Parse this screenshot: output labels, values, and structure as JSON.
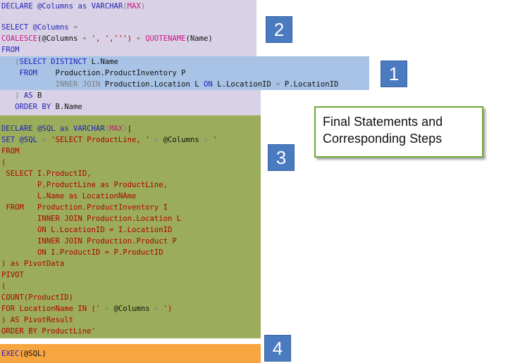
{
  "callout": {
    "line1": "Final Statements and",
    "line2": "Corresponding Steps"
  },
  "badges": [
    "2",
    "1",
    "3",
    "4"
  ],
  "colors": {
    "step2_bg": "#d9d2e6",
    "step1_bg": "#a8c3e6",
    "step3_bg": "#9bad5b",
    "step4_bg": "#f7a541",
    "badge_bg": "#4a7ac0",
    "callout_border": "#6aaa3a"
  },
  "step2": {
    "declare": [
      "DECLARE @Columns ",
      "as ",
      "VARCHAR",
      "(",
      "MAX",
      ")"
    ],
    "select": [
      "SELECT @Columns ",
      "="
    ],
    "coalesce": [
      "COALESCE",
      "(@Columns ",
      "+ ",
      "', ','",
      "'') ",
      "+ ",
      "QUOTENAME",
      "(Name)"
    ],
    "from": "FROM",
    "as_b": [
      "   ) ",
      "AS ",
      "B"
    ],
    "order": [
      "   ",
      "ORDER BY ",
      "B.Name"
    ]
  },
  "step1": {
    "line1": [
      "   (",
      "SELECT DISTINCT ",
      "L.Name"
    ],
    "line2": [
      "    ",
      "FROM    ",
      "Production.ProductInventory P"
    ],
    "line3": [
      "            ",
      "INNER JOIN ",
      "Production.Location L ",
      "ON ",
      "L.LocationID ",
      "= ",
      "P.LocationID"
    ]
  },
  "step3": {
    "lines": [
      "DECLARE @SQL as VARCHAR(MAX)",
      "SET @SQL = 'SELECT ProductLine, ' + @Columns + '",
      "FROM",
      "(",
      " SELECT I.ProductID,",
      "        P.ProductLine as ProductLine,",
      "        L.Name as LocationNAme",
      " FROM   Production.ProductInventory I",
      "        INNER JOIN Production.Location L",
      "        ON L.LocationID = I.LocationID",
      "        INNER JOIN Production.Product P",
      "        ON I.ProductID = P.ProductID",
      ") as PivotData",
      "PIVOT",
      "(",
      "COUNT(ProductID)",
      "FOR LocationName IN (' + @Columns + ')",
      ") AS PivotResult",
      "ORDER BY ProductLine'"
    ]
  },
  "step4": {
    "exec": [
      "EXEC",
      "(@SQL)"
    ]
  }
}
